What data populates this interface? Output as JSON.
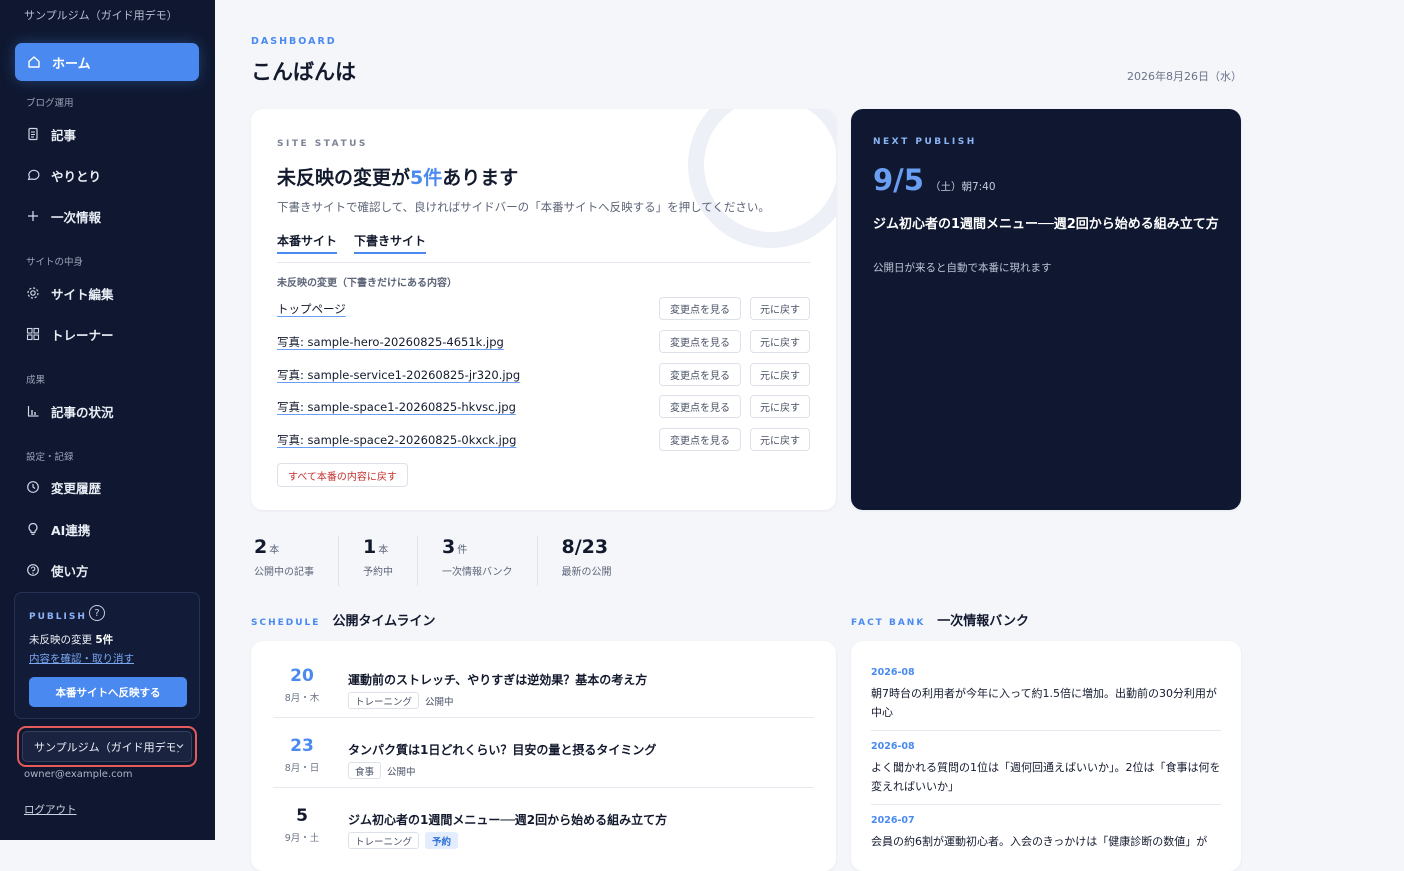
{
  "sidebar": {
    "brand": "サンプルジム（ガイド用デモ）",
    "home": "ホーム",
    "sections": {
      "blog": "ブログ運用",
      "site": "サイトの中身",
      "results": "成果",
      "settings": "設定・記録"
    },
    "items": {
      "articles": "記事",
      "conversations": "やりとり",
      "facts": "一次情報",
      "site_edit": "サイト編集",
      "trainers": "トレーナー",
      "article_status": "記事の状況",
      "history": "変更履歴",
      "ai": "AI連携",
      "howto": "使い方"
    },
    "publish": {
      "label": "PUBLISH",
      "help": "?",
      "pending_prefix": "未反映の変更",
      "pending_count": "5件",
      "review_link": "内容を確認・取り消す",
      "button": "本番サイトへ反映する"
    },
    "site_select": "サンプルジム（ガイド用デモ）",
    "email": "owner@example.com",
    "logout": "ログアウト"
  },
  "header": {
    "eyebrow": "DASHBOARD",
    "title": "こんばんは",
    "date": "2026年8月26日（水）"
  },
  "status": {
    "eyebrow": "SITE STATUS",
    "head_prefix": "未反映の変更が",
    "head_count": "5件",
    "head_suffix": "あります",
    "sub": "下書きサイトで確認して、良ければサイドバーの「本番サイトへ反映する」を押してください。",
    "tab_live": "本番サイト",
    "tab_draft": "下書きサイト",
    "changes_label": "未反映の変更（下書きだけにある内容）",
    "diff_label": "変更点を見る",
    "revert_label": "元に戻す",
    "changes": [
      "トップページ",
      "写真: sample-hero-20260825-4651k.jpg",
      "写真: sample-service1-20260825-jr320.jpg",
      "写真: sample-space1-20260825-hkvsc.jpg",
      "写真: sample-space2-20260825-0kxck.jpg"
    ],
    "revert_all": "すべて本番の内容に戻す"
  },
  "next_publish": {
    "eyebrow": "NEXT PUBLISH",
    "date": "9/5",
    "detail": "（土）朝7:40",
    "title": "ジム初心者の1週間メニュー──週2回から始める組み立て方",
    "note": "公開日が来ると自動で本番に現れます"
  },
  "stats": [
    {
      "num": "2",
      "unit": "本",
      "label": "公開中の記事"
    },
    {
      "num": "1",
      "unit": "本",
      "label": "予約中"
    },
    {
      "num": "3",
      "unit": "件",
      "label": "一次情報バンク"
    },
    {
      "num": "8/23",
      "unit": "",
      "label": "最新の公開"
    }
  ],
  "schedule": {
    "eyebrow": "SCHEDULE",
    "title": "公開タイムライン",
    "items": [
      {
        "day": "20",
        "dow": "8月・木",
        "title": "運動前のストレッチ、やりすぎは逆効果？基本の考え方",
        "tag": "トレーニング",
        "status": "公開中"
      },
      {
        "day": "23",
        "dow": "8月・日",
        "title": "タンパク質は1日どれくらい？目安の量と摂るタイミング",
        "tag": "食事",
        "status": "公開中"
      },
      {
        "day": "5",
        "dow": "9月・土",
        "title": "ジム初心者の1週間メニュー──週2回から始める組み立て方",
        "tag": "トレーニング",
        "status": "予約"
      }
    ]
  },
  "factbank": {
    "eyebrow": "FACT BANK",
    "title": "一次情報バンク",
    "items": [
      {
        "date": "2026-08",
        "text": "朝7時台の利用者が今年に入って約1.5倍に増加。出勤前の30分利用が中心"
      },
      {
        "date": "2026-08",
        "text": "よく聞かれる質問の1位は「週何回通えばいいか」。2位は「食事は何を変えればいいか」"
      },
      {
        "date": "2026-07",
        "text": "会員の約6割が運動初心者。入会のきっかけは「健康診断の数値」が"
      }
    ]
  },
  "colors": {
    "accent": "#4a8af0",
    "sidebar_bg": "#0f1830",
    "danger": "#c4322f",
    "highlight_ring": "#e35b5b"
  }
}
